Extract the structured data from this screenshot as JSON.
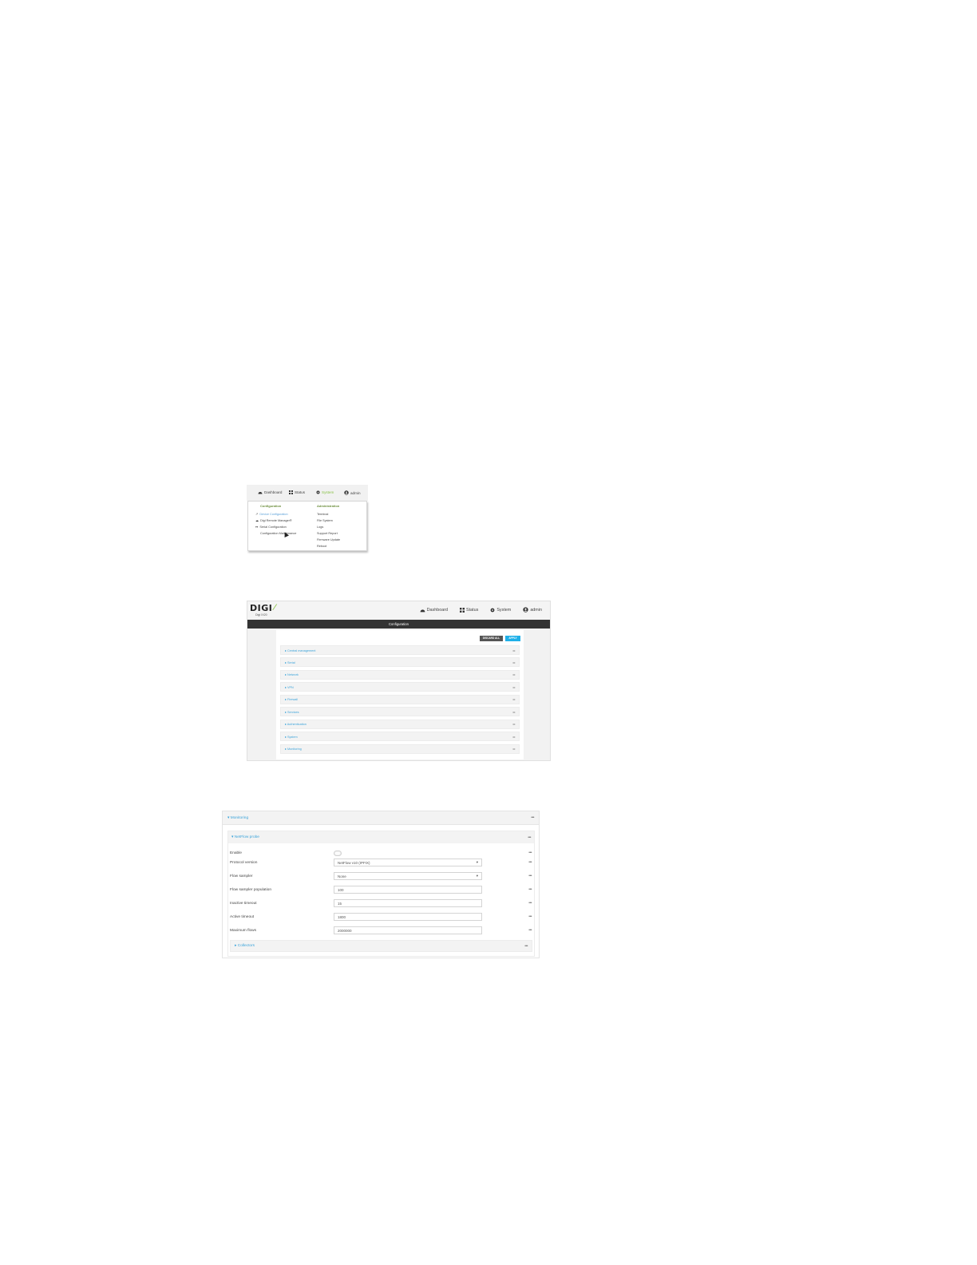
{
  "menu_shot": {
    "nav": [
      {
        "label": "Dashboard",
        "icon": "dashboard-icon"
      },
      {
        "label": "Status",
        "icon": "grid-icon"
      },
      {
        "label": "System",
        "icon": "gear-icon",
        "active": true
      },
      {
        "label": "admin",
        "icon": "user-icon"
      }
    ],
    "configuration_header": "Configuration",
    "configuration_items": [
      {
        "label": "Device Configuration",
        "icon": "wrench-icon",
        "highlighted": true
      },
      {
        "label": "Digi Remote Manager®",
        "icon": "cloud-icon"
      },
      {
        "label": "Serial Configuration",
        "icon": "serial-icon"
      },
      {
        "label": "Configuration Maintenance",
        "icon": ""
      }
    ],
    "administration_header": "Administration",
    "administration_items": [
      "Terminal",
      "File System",
      "Logs",
      "Support Report",
      "Firmware Update",
      "Reboot"
    ]
  },
  "config_shot": {
    "logo_text": "DIGI",
    "logo_sub": "Digi IX20",
    "nav": [
      {
        "label": "Dashboard",
        "icon": "dashboard-icon"
      },
      {
        "label": "Status",
        "icon": "grid-icon"
      },
      {
        "label": "System",
        "icon": "gear-icon"
      },
      {
        "label": "admin",
        "icon": "user-icon"
      }
    ],
    "title": "Configuration",
    "discard_label": "DISCARD ALL",
    "apply_label": "APPLY",
    "sections": [
      "Central management",
      "Serial",
      "Network",
      "VPN",
      "Firewall",
      "Services",
      "Authentication",
      "System",
      "Monitoring"
    ]
  },
  "netflow_shot": {
    "section_label": "Monitoring",
    "subsection_label": "NetFlow probe",
    "fields": [
      {
        "label": "Enable",
        "type": "toggle",
        "value": ""
      },
      {
        "label": "Protocol version",
        "type": "select",
        "value": "NetFlow v10 (IPFIX)"
      },
      {
        "label": "Flow sampler",
        "type": "select",
        "value": "None"
      },
      {
        "label": "Flow sampler population",
        "type": "text",
        "value": "100"
      },
      {
        "label": "Inactive timeout",
        "type": "text",
        "value": "15"
      },
      {
        "label": "Active timeout",
        "type": "text",
        "value": "1800"
      },
      {
        "label": "Maximum flows",
        "type": "text",
        "value": "2000000"
      }
    ],
    "collectors_label": "Collectors"
  }
}
